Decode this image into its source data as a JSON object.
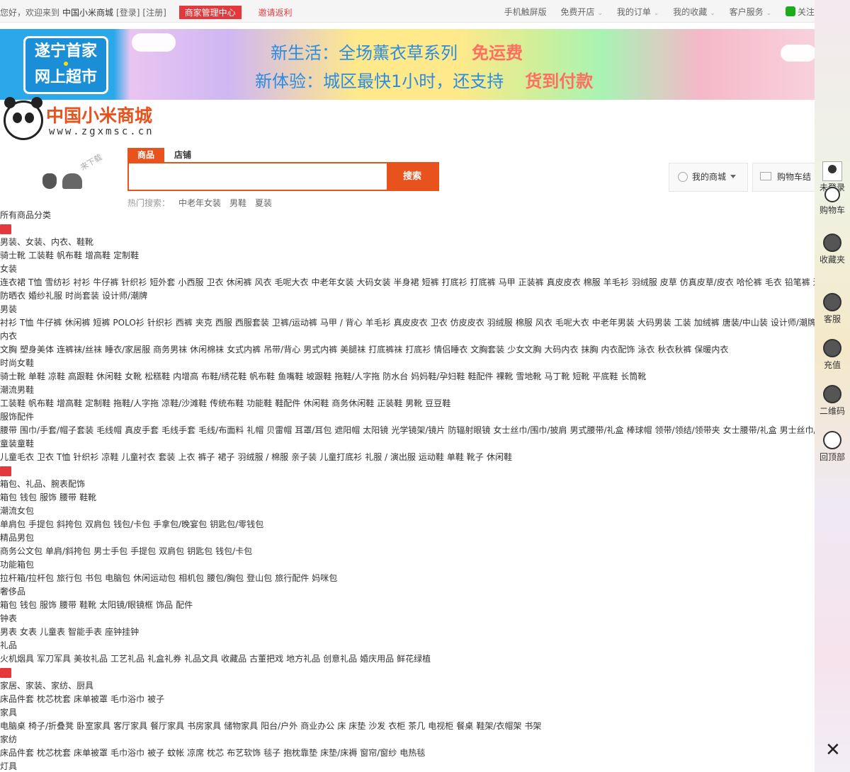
{
  "topbar": {
    "greeting": "您好，欢迎来到",
    "site_name": "中国小米商城",
    "login": "[登录]",
    "register": "[注册]",
    "merchant": "商家管理中心",
    "invite": "邀请返利",
    "right": [
      "手机触屏版",
      "免费开店",
      "我的订单",
      "我的收藏",
      "客户服务"
    ],
    "wechat": "关注"
  },
  "banner": {
    "logo_line1": "遂宁首家",
    "logo_line2": "网上超市",
    "line1_a": "新生活：全场薰衣草系列",
    "line1_b": "免运费",
    "line2_a": "新体验：城区最快1小时，还支持",
    "line2_b": "货到付款"
  },
  "logo": {
    "title": "中国小米商城",
    "url": "www.zgxmsc.cn"
  },
  "app": {
    "label": "来下载"
  },
  "search": {
    "tabs": [
      "商品",
      "店铺"
    ],
    "button": "搜索",
    "placeholder": "",
    "hot_label": "热门搜索：",
    "hot": [
      "中老年女装",
      "男鞋",
      "夏装"
    ]
  },
  "header_actions": {
    "mymall": "我的商城",
    "cart": "购物车结"
  },
  "categories_title": "所有商品分类",
  "categories": [
    {
      "title": "男装、女装、内衣、鞋靴",
      "groups": [
        {
          "links": [
            "骑士靴",
            "工装鞋",
            "帆布鞋",
            "增高鞋",
            "定制鞋"
          ]
        },
        {
          "name": "女装",
          "links": [
            "连衣裙",
            "T恤",
            "雪纺衫",
            "衬衫",
            "牛仔裤",
            "针织衫",
            "短外套",
            "小西服",
            "卫衣",
            "休闲裤",
            "风衣",
            "毛呢大衣",
            "中老年女装",
            "大码女装",
            "半身裙",
            "短裤",
            "打底衫",
            "打底裤",
            "马甲",
            "正装裤",
            "真皮皮衣",
            "棉服",
            "羊毛衫",
            "羽绒服",
            "皮草",
            "仿真皮草/皮衣",
            "哈伦裤",
            "毛衣",
            "铅笔裤",
            "连体裤"
          ]
        },
        {
          "links": [
            "防晒衣",
            "婚纱礼服",
            "时尚套装",
            "设计师/潮牌"
          ]
        },
        {
          "name": "男装",
          "links": [
            "衬衫",
            "T恤",
            "牛仔裤",
            "休闲裤",
            "短裤",
            "POLO衫",
            "针织衫",
            "西裤",
            "夹克",
            "西服",
            "西服套装",
            "卫裤/运动裤",
            "马甲 / 背心",
            "羊毛衫",
            "真皮皮衣",
            "卫衣",
            "仿皮皮衣",
            "羽绒服",
            "棉服",
            "风衣",
            "毛呢大衣",
            "中老年男装",
            "大码男装",
            "工装",
            "加绒裤",
            "唐装/中山装",
            "设计师/潮牌"
          ]
        },
        {
          "name": "内衣",
          "links": [
            "文胸",
            "塑身美体",
            "连裤袜/丝袜",
            "睡衣/家居服",
            "商务男袜",
            "休闲棉袜",
            "女式内裤",
            "吊带/背心",
            "男式内裤",
            "美腿袜",
            "打底裤袜",
            "打底衫",
            "情侣睡衣",
            "文胸套装",
            "少女文胸",
            "大码内衣",
            "抹胸",
            "内衣配饰",
            "泳衣",
            "秋衣秋裤",
            "保暖内衣"
          ]
        },
        {
          "name": "时尚女鞋",
          "links": [
            "骑士靴",
            "单鞋",
            "凉鞋",
            "高跟鞋",
            "休闲鞋",
            "女靴",
            "松糕鞋",
            "内增高",
            "布鞋/绣花鞋",
            "帆布鞋",
            "鱼嘴鞋",
            "坡跟鞋",
            "拖鞋/人字拖",
            "防水台",
            "妈妈鞋/孕妇鞋",
            "鞋配件",
            "裸靴",
            "雪地靴",
            "马丁靴",
            "短靴",
            "平底鞋",
            "长筒靴"
          ]
        },
        {
          "name": "潮流男鞋",
          "links": [
            "工装鞋",
            "帆布鞋",
            "增高鞋",
            "定制鞋",
            "拖鞋/人字拖",
            "凉鞋/沙滩鞋",
            "传统布鞋",
            "功能鞋",
            "鞋配件",
            "休闲鞋",
            "商务休闲鞋",
            "正装鞋",
            "男靴",
            "豆豆鞋"
          ]
        },
        {
          "name": "服饰配件",
          "links": [
            "腰带",
            "围巾/手套/帽子套装",
            "毛线帽",
            "真皮手套",
            "毛线手套",
            "毛线/布面料",
            "礼帽",
            "贝雷帽",
            "耳罩/耳包",
            "遮阳帽",
            "太阳镜",
            "光学镜架/镜片",
            "防辐射眼镜",
            "女士丝巾/围巾/披肩",
            "男式腰带/礼盒",
            "棒球帽",
            "领带/领结/领带夹",
            "女士腰带/礼盒",
            "男士丝巾/围巾"
          ]
        },
        {
          "name": "童装童鞋",
          "links": [
            "儿童毛衣",
            "卫衣",
            "T恤",
            "针织衫",
            "凉鞋",
            "儿童衬衣",
            "套装",
            "上衣",
            "裤子",
            "裙子",
            "羽绒服 / 棉服",
            "亲子装",
            "儿童打底衫",
            "礼服 / 演出服",
            "运动鞋",
            "单鞋",
            "靴子",
            "休闲鞋"
          ]
        }
      ]
    },
    {
      "title": "箱包、礼品、腕表配饰",
      "groups": [
        {
          "links": [
            "箱包",
            "钱包",
            "服饰",
            "腰带",
            "鞋靴"
          ]
        },
        {
          "name": "潮流女包",
          "links": [
            "单肩包",
            "手提包",
            "斜挎包",
            "双肩包",
            "钱包/卡包",
            "手拿包/晚宴包",
            "钥匙包/零钱包"
          ]
        },
        {
          "name": "精品男包",
          "links": [
            "商务公文包",
            "单肩/斜挎包",
            "男士手包",
            "手提包",
            "双肩包",
            "钥匙包",
            "钱包/卡包"
          ]
        },
        {
          "name": "功能箱包",
          "links": [
            "拉杆箱/拉杆包",
            "旅行包",
            "书包",
            "电脑包",
            "休闲运动包",
            "相机包",
            "腰包/胸包",
            "登山包",
            "旅行配件",
            "妈咪包"
          ]
        },
        {
          "name": "奢侈品",
          "links": [
            "箱包",
            "钱包",
            "服饰",
            "腰带",
            "鞋靴",
            "太阳镜/眼镜框",
            "饰品",
            "配件"
          ]
        },
        {
          "name": "钟表",
          "links": [
            "男表",
            "女表",
            "儿童表",
            "智能手表",
            "座钟挂钟"
          ]
        },
        {
          "name": "礼品",
          "links": [
            "火机烟具",
            "军刀军具",
            "美妆礼品",
            "工艺礼品",
            "礼盒礼券",
            "礼品文具",
            "收藏品",
            "古董把戏",
            "地方礼品",
            "创意礼品",
            "婚庆用品",
            "鲜花绿植"
          ]
        }
      ]
    },
    {
      "title": "家居、家装、家纺、厨具",
      "groups": [
        {
          "links": [
            "床品件套",
            "枕芯枕套",
            "床单被罩",
            "毛巾浴巾",
            "被子"
          ]
        },
        {
          "name": "家具",
          "links": [
            "电脑桌",
            "椅子/折叠凳",
            "卧室家具",
            "客厅家具",
            "餐厅家具",
            "书房家具",
            "储物家具",
            "阳台/户外",
            "商业办公",
            "床",
            "床垫",
            "沙发",
            "衣柜",
            "茶几",
            "电视柜",
            "餐桌",
            "鞋架/衣帽架",
            "书架"
          ]
        },
        {
          "name": "家纺",
          "links": [
            "床品件套",
            "枕芯枕套",
            "床单被罩",
            "毛巾浴巾",
            "被子",
            "蚊帐",
            "凉席",
            "枕芯",
            "布艺软饰",
            "毯子",
            "抱枕靠垫",
            "床垫/床褥",
            "窗帘/窗纱",
            "电热毯"
          ]
        },
        {
          "name": "灯具",
          "links": []
        }
      ]
    }
  ],
  "sidebar": {
    "items": [
      "未登录",
      "购物车",
      "收藏夹",
      "客服",
      "充值",
      "二维码",
      "回顶部"
    ]
  },
  "colors": {
    "accent": "#e8521d",
    "merchant": "#e4393c"
  }
}
